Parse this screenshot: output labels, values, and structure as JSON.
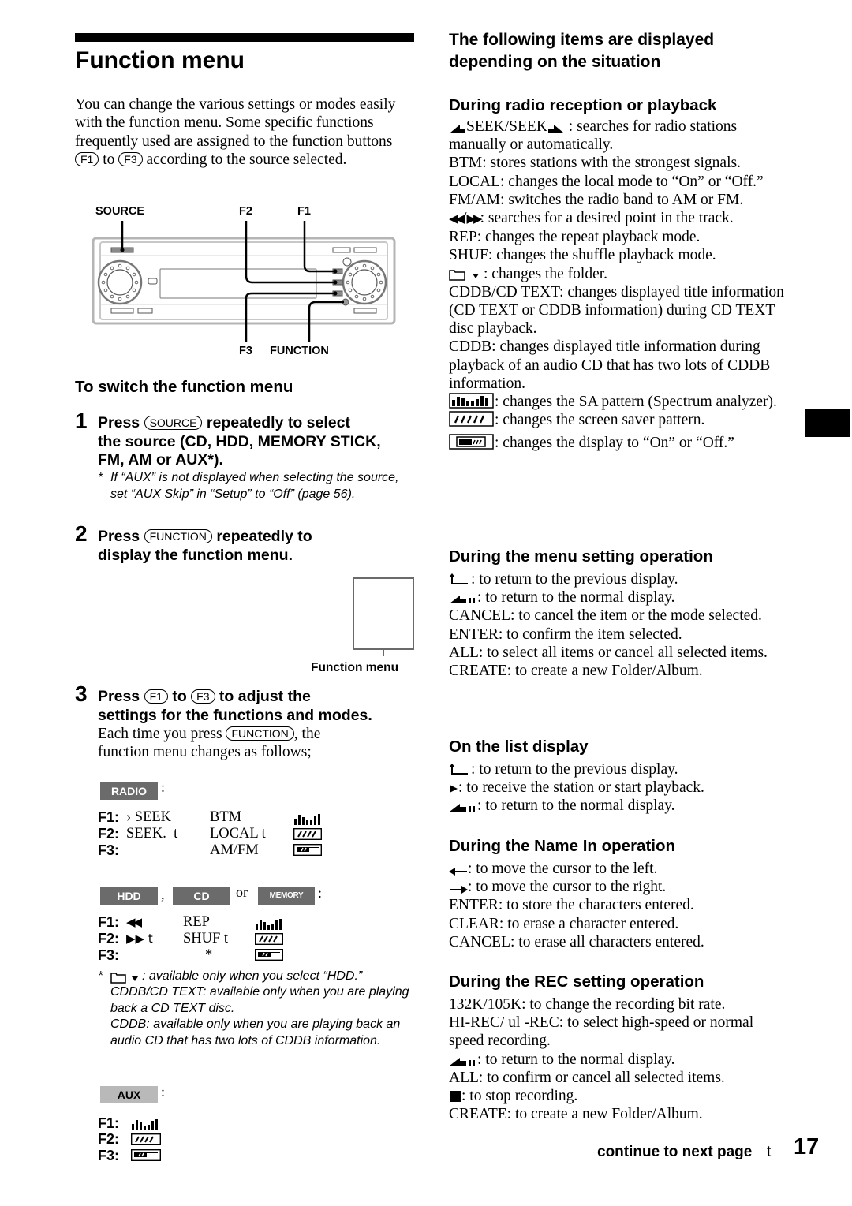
{
  "page": {
    "title": "Function menu",
    "intro": {
      "part1": "You can change the various settings or modes easily with the function menu. Some specific functions frequently used are assigned to the function buttons",
      "key_f1": "F1",
      "to": "to",
      "key_f3": "F3",
      "part2": "according to the source selected."
    },
    "diagram": {
      "labels": {
        "source": "SOURCE",
        "f2": "F2",
        "f1": "F1",
        "f3": "F3",
        "function": "FUNCTION"
      }
    },
    "switch_section": {
      "title": "To switch the function menu",
      "steps": [
        {
          "num": "1",
          "press": "Press",
          "key": "SOURCE",
          "text_a": "repeatedly to select",
          "text_b": "the source (CD, HDD, MEMORY STICK,",
          "text_c": "FM, AM or AUX*).",
          "note_star": "*",
          "note": "If “AUX” is not displayed when selecting the source, set “AUX Skip” in “Setup” to “Off” (page 56)."
        },
        {
          "num": "2",
          "press": "Press",
          "key": "FUNCTION",
          "text_a": "repeatedly to",
          "text_b": "display the function menu."
        },
        {
          "num": "3",
          "press": "Press",
          "key_a": "F1",
          "to": "to",
          "key_b": "F3",
          "text_a": "to adjust the",
          "text_b": "settings for the functions and modes.",
          "body_a": "Each time you press",
          "body_key": "FUNCTION",
          "body_b": ", the",
          "body_c": "function menu changes as follows;"
        }
      ],
      "function_menu_label": "Function menu"
    },
    "menus": {
      "radio": {
        "badge": "RADIO",
        "colon": ":",
        "rows": [
          {
            "key": "F1:",
            "a": "› SEEK",
            "b": "BTM",
            "icon": "spectrum-analyzer-icon"
          },
          {
            "key": "F2:",
            "a": "SEEK.  t",
            "b": "LOCAL t",
            "icon": "screen-saver-icon"
          },
          {
            "key": "F3:",
            "a": "",
            "b": "AM/FM",
            "icon": "display-icon"
          }
        ]
      },
      "disc": {
        "badge_hdd": "HDD",
        "comma": ",",
        "badge_cd": "CD",
        "or": "or",
        "badge_ms": "MEMORY STICK",
        "colon": ":",
        "rows": [
          {
            "key": "F1:",
            "a": "◀◀",
            "b": "REP",
            "icon": "spectrum-analyzer-icon"
          },
          {
            "key": "F2:",
            "a": "▶▶ t",
            "b": "SHUF t",
            "icon": "screen-saver-icon"
          },
          {
            "key": "F3:",
            "a": "",
            "b": "*",
            "icon": "display-icon"
          }
        ],
        "footnote": {
          "star": "*",
          "line1": ": available only when you select “HDD.”",
          "line2": "CDDB/CD TEXT: available only when you are playing back a CD TEXT disc.",
          "line3": "CDDB: available only when you are playing back an audio CD that has two lots of CDDB information."
        }
      },
      "aux": {
        "badge": "AUX",
        "colon": ":",
        "rows": [
          {
            "key": "F1:",
            "icon": "spectrum-analyzer-icon"
          },
          {
            "key": "F2:",
            "icon": "screen-saver-icon"
          },
          {
            "key": "F3:",
            "icon": "display-icon"
          }
        ]
      }
    },
    "right": {
      "title": "The following items are displayed depending on the situation",
      "radio": {
        "title": "During radio reception or playback",
        "seek": "SEEK/SEEK",
        "seek_desc": " : searches for radio stations manually or automatically.",
        "btm": "BTM: stores stations with the strongest signals.",
        "local": "LOCAL: changes the local mode to “On” or “Off.”",
        "fmam": "FM/AM: switches the radio band to AM or FM.",
        "search": "/",
        "search_desc": ": searches for a desired point in the track.",
        "rep": "REP: changes the repeat playback mode.",
        "shuf": "SHUF: changes the shuffle playback mode.",
        "folder_desc": ": changes the folder.",
        "cddb_text": "CDDB/CD TEXT: changes displayed title information (CD TEXT or CDDB information) during CD TEXT disc playback.",
        "cddb": "CDDB: changes displayed title information during playback of an audio CD that has two lots of CDDB information.",
        "sa_desc": ": changes the SA pattern (Spectrum analyzer).",
        "saver_desc": ": changes the screen saver pattern.",
        "display_desc": ": changes the display to “On” or “Off.”"
      },
      "menu_setting": {
        "title": "During the menu setting operation",
        "back_desc": ": to return to the previous display.",
        "normal_desc": ": to return to the normal display.",
        "cancel": "CANCEL: to cancel the item or the mode selected.",
        "enter": "ENTER: to confirm the item selected.",
        "all": "ALL: to select all items or cancel all selected items.",
        "create": "CREATE: to create a new Folder/Album."
      },
      "list_display": {
        "title": "On the list display",
        "back_desc": ": to return to the previous display.",
        "play_desc": ": to receive the station or start playback.",
        "normal_desc": ": to return to the normal display."
      },
      "name_in": {
        "title": "During the Name In operation",
        "left_desc": ": to move the cursor to the left.",
        "right_desc": ": to move the cursor to the right.",
        "enter": "ENTER: to store the characters entered.",
        "clear": "CLEAR: to erase a character entered.",
        "cancel": "CANCEL: to erase all characters entered."
      },
      "rec": {
        "title": "During the REC setting operation",
        "bitrate": "132K/105K: to change the recording bit rate.",
        "hirec": "HI-REC/ ul -REC: to select high-speed or normal speed recording.",
        "normal_desc": ": to return to the normal display.",
        "all": "ALL: to confirm or cancel all selected items.",
        "stop_desc": ": to stop recording.",
        "create": "CREATE: to create a new Folder/Album."
      }
    },
    "footer": {
      "continue": "continue to next page",
      "arrow": "t",
      "page_number": "17"
    }
  }
}
